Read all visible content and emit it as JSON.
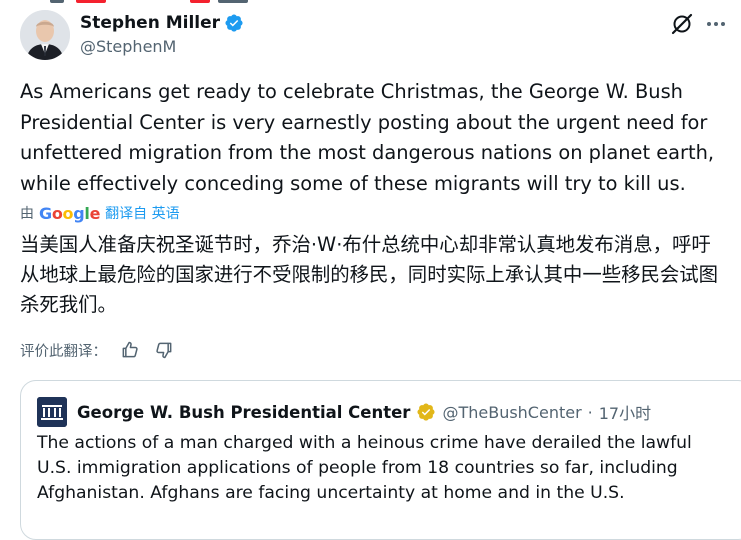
{
  "tweet": {
    "author": {
      "name": "Stephen Miller",
      "handle": "@StephenM"
    },
    "text": "As Americans get ready to celebrate Christmas, the George W. Bush Presidential Center is very earnestly posting about the urgent need for unfettered migration from the most dangerous nations on planet earth, while effectively conceding some of these migrants will try to kill us.",
    "translation": {
      "by_label": "由",
      "provider": "Google",
      "link_label": "翻译自 英语",
      "text": "当美国人准备庆祝圣诞节时，乔治·W·布什总统中心却非常认真地发布消息，呼吁从地球上最危险的国家进行不受限制的移民，同时实际上承认其中一些移民会试图杀死我们。",
      "rate_label": "评价此翻译："
    }
  },
  "quote": {
    "author": {
      "name": "George W. Bush Presidential Center",
      "handle": "@TheBushCenter",
      "separator": "·",
      "time": "17小时"
    },
    "text": "The actions of a man charged with a heinous crime have derailed the lawful U.S. immigration applications of people from 18 countries so far, including Afghanistan. Afghans are facing uncertainty at home and in the U.S."
  },
  "colors": {
    "verified_blue": "#1d9bf0",
    "verified_gold": "#e2b719",
    "link_blue": "#1d9bf0",
    "secondary_text": "#536471"
  },
  "icons": [
    "verified-badge-icon",
    "grok-icon",
    "more-icon",
    "thumbs-up-icon",
    "thumbs-down-icon",
    "bush-center-logo"
  ]
}
